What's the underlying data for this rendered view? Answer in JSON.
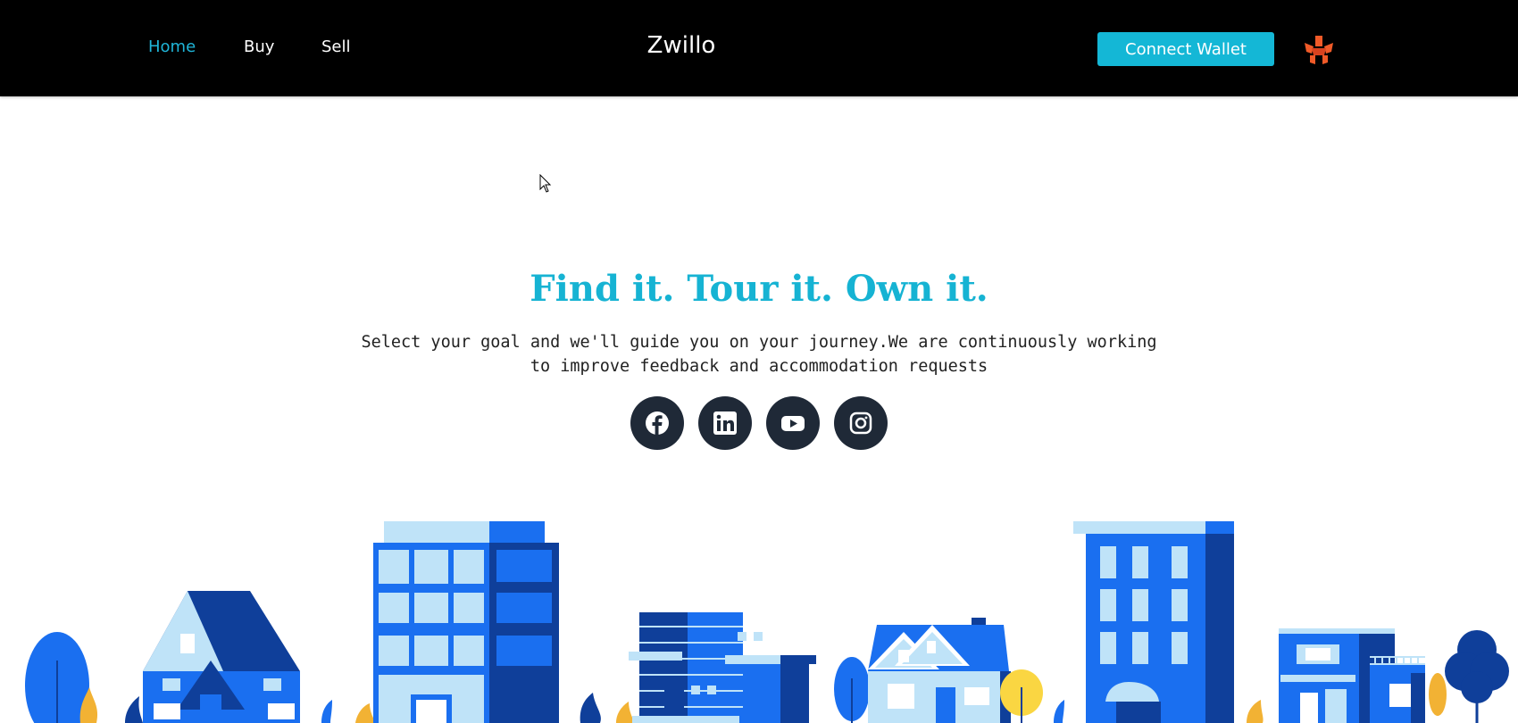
{
  "nav": {
    "links": [
      {
        "label": "Home",
        "active": true
      },
      {
        "label": "Buy",
        "active": false
      },
      {
        "label": "Sell",
        "active": false
      }
    ],
    "brand": "Zwillo",
    "connect_label": "Connect Wallet",
    "wallet_icon": "metamask-fox-icon"
  },
  "hero": {
    "title": "Find it. Tour it. Own it.",
    "subtitle_line1": "Select your goal and we'll guide you on your journey.We are continuously working",
    "subtitle_line2": "to improve feedback and accommodation requests"
  },
  "social": [
    "facebook-icon",
    "linkedin-icon",
    "youtube-icon",
    "instagram-icon"
  ],
  "colors": {
    "accent": "#14b7d6",
    "nav_bg": "#000000",
    "social_bg": "#1f2937",
    "city_blue": "#1a6ff0",
    "city_dark": "#0f3f9a",
    "city_light": "#bfe3f8",
    "city_yellow": "#f2b234"
  }
}
